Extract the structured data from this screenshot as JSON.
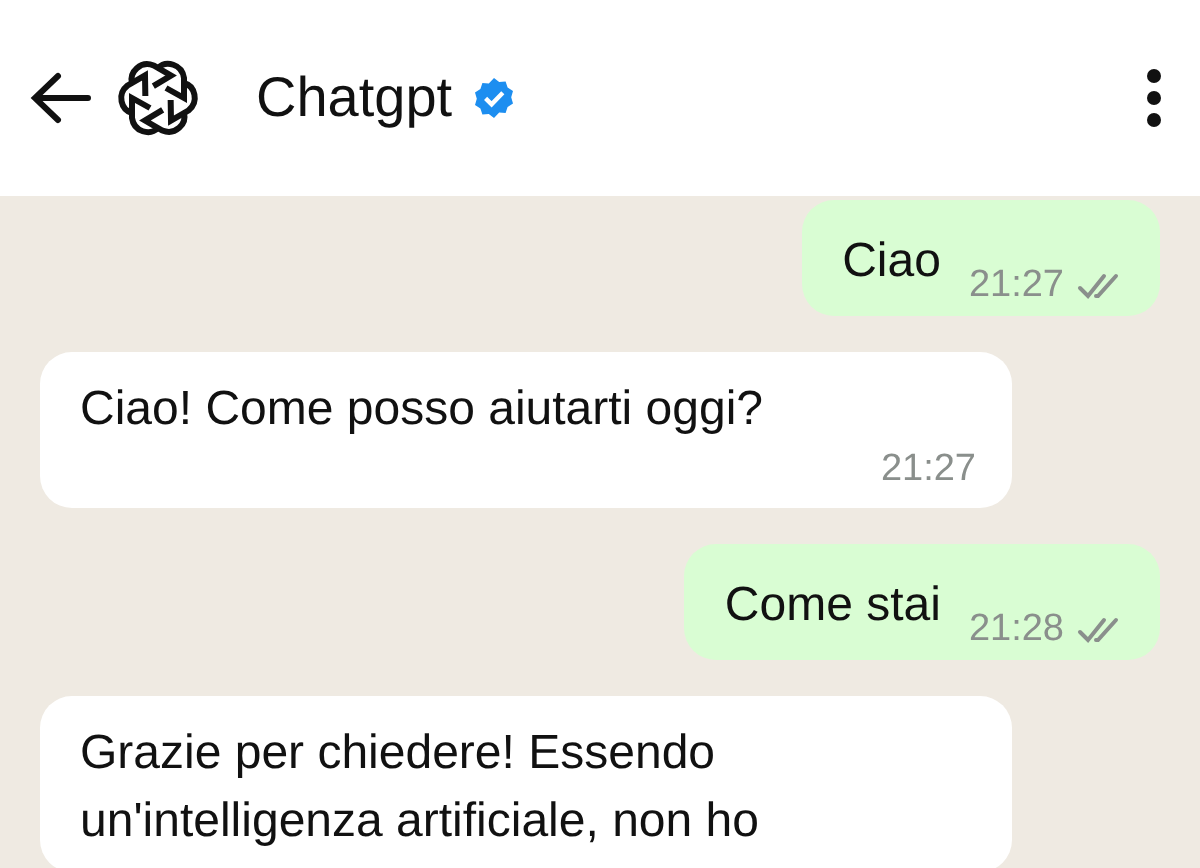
{
  "header": {
    "title": "Chatgpt",
    "verified": true
  },
  "messages": [
    {
      "kind": "outgoing",
      "text": "Ciao",
      "time": "21:27",
      "read": false
    },
    {
      "kind": "incoming",
      "text": "Ciao! Come posso aiutarti oggi?",
      "time": "21:27"
    },
    {
      "kind": "outgoing",
      "text": "Come stai",
      "time": "21:28",
      "read": false
    },
    {
      "kind": "incoming",
      "text": "Grazie per chiedere! Essendo un'intelligenza artificiale, non ho"
    }
  ]
}
